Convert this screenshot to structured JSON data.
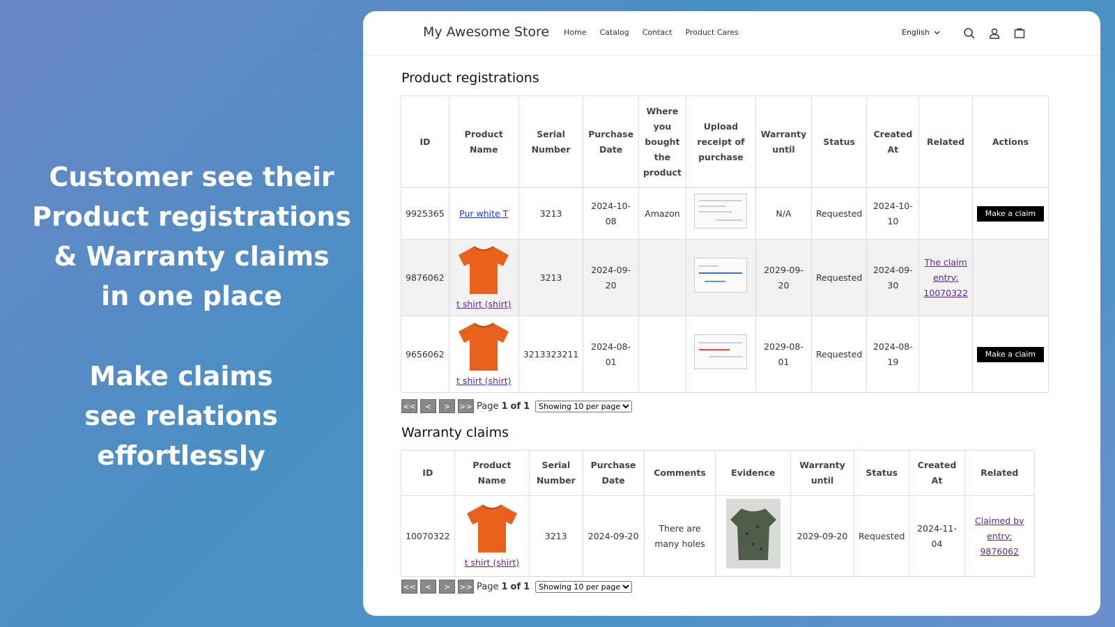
{
  "promo": {
    "headline_lines": [
      "Customer see their",
      "Product registrations",
      "& Warranty claims",
      "in one place"
    ],
    "sub_lines": [
      "Make claims",
      "see relations",
      "effortlessly"
    ]
  },
  "store": {
    "title": "My Awesome Store",
    "nav": [
      "Home",
      "Catalog",
      "Contact",
      "Product Cares"
    ],
    "language": "English"
  },
  "registrations": {
    "title": "Product registrations",
    "headers": [
      "ID",
      "Product Name",
      "Serial Number",
      "Purchase Date",
      "Where you bought the product",
      "Upload receipt of purchase",
      "Warranty until",
      "Status",
      "Created At",
      "Related",
      "Actions"
    ],
    "rows": [
      {
        "id": "9925365",
        "product": "Pur white T",
        "serial": "3213",
        "purchase_date": "2024-10-08",
        "where": "Amazon",
        "warranty": "N/A",
        "status": "Requested",
        "created": "2024-10-10",
        "related": "",
        "action": "Make a claim"
      },
      {
        "id": "9876062",
        "product": "t shirt (shirt)",
        "serial": "3213",
        "purchase_date": "2024-09-20",
        "where": "",
        "warranty": "2029-09-20",
        "status": "Requested",
        "created": "2024-09-30",
        "related": "The claim entry: 10070322",
        "action": ""
      },
      {
        "id": "9656062",
        "product": "t shirt (shirt)",
        "serial": "3213323211",
        "purchase_date": "2024-08-01",
        "where": "",
        "warranty": "2029-08-01",
        "status": "Requested",
        "created": "2024-08-19",
        "related": "",
        "action": "Make a claim"
      }
    ],
    "pager": {
      "first": "<<",
      "prev": "<",
      "next": ">",
      "last": ">>",
      "page_word": "Page",
      "page": "1",
      "of_word": "of",
      "total": "1",
      "per_page": "Showing 10 per page"
    }
  },
  "claims": {
    "title": "Warranty claims",
    "headers": [
      "ID",
      "Product Name",
      "Serial Number",
      "Purchase Date",
      "Comments",
      "Evidence",
      "Warranty until",
      "Status",
      "Created At",
      "Related"
    ],
    "rows": [
      {
        "id": "10070322",
        "product": "t shirt (shirt)",
        "serial": "3213",
        "purchase_date": "2024-09-20",
        "comments": "There are many holes",
        "warranty": "2029-09-20",
        "status": "Requested",
        "created": "2024-11-04",
        "related": "Claimed by entry: 9876062"
      }
    ],
    "pager": {
      "first": "<<",
      "prev": "<",
      "next": ">",
      "last": ">>",
      "page_word": "Page",
      "page": "1",
      "of_word": "of",
      "total": "1",
      "per_page": "Showing 10 per page"
    }
  },
  "colors": {
    "shirt": "#e8611c",
    "button": "#000000",
    "link": "#5a2a8a",
    "link_blue": "#1a3bd6"
  }
}
